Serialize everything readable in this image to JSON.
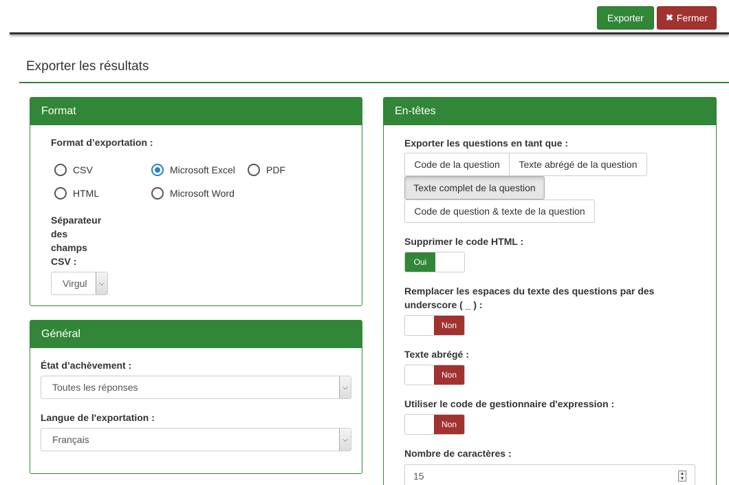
{
  "toolbar": {
    "export_label": "Exporter",
    "close_label": "Fermer",
    "close_icon": "✖"
  },
  "page": {
    "title": "Exporter les résultats"
  },
  "format_panel": {
    "title": "Format",
    "export_format_label": "Format d’exportation :",
    "options": [
      {
        "label": "CSV",
        "selected": false
      },
      {
        "label": "Microsoft Excel",
        "selected": true
      },
      {
        "label": "PDF",
        "selected": false
      },
      {
        "label": "HTML",
        "selected": false
      },
      {
        "label": "Microsoft Word",
        "selected": false
      }
    ],
    "separator_label_lines": [
      "Séparateur",
      "des",
      "champs",
      "CSV :"
    ],
    "separator_value": "Virgul"
  },
  "general_panel": {
    "title": "Général",
    "completion_label": "État d’achèvement :",
    "completion_value": "Toutes les réponses",
    "language_label": "Langue de l'exportation :",
    "language_value": "Français"
  },
  "headers_panel": {
    "title": "En-têtes",
    "questions_label": "Exporter les questions en tant que :",
    "question_options": [
      {
        "label": "Code de la question",
        "active": false
      },
      {
        "label": "Texte abrégé de la question",
        "active": false
      },
      {
        "label": "Texte complet de la question",
        "active": true
      },
      {
        "label": "Code de question & texte de la question",
        "active": false
      }
    ],
    "strip_html_label": "Supprimer le code HTML :",
    "strip_html_value": "Oui",
    "replace_spaces_label_lines": [
      "Remplacer les espaces du texte des questions par des",
      "underscore ( _ ) :"
    ],
    "replace_spaces_value": "Non",
    "abbreviated_label": "Texte abrégé :",
    "abbreviated_value": "Non",
    "expression_code_label": "Utiliser le code de gestionnaire d'expression :",
    "expression_code_value": "Non",
    "char_count_label": "Nombre de caractères :",
    "char_count_value": "15"
  },
  "colors": {
    "accent": "#328637",
    "danger": "#a03230",
    "radio_selected": "#2d7ec9"
  }
}
